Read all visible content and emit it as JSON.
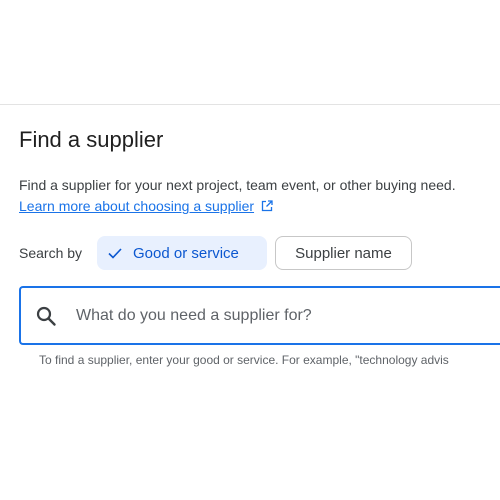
{
  "page": {
    "title": "Find a supplier",
    "description": "Find a supplier for your next project, team event, or other buying need.",
    "learn_more_link": "Learn more about choosing a supplier",
    "learn_more_icon": "external-link-icon"
  },
  "search_by": {
    "label": "Search by",
    "options": [
      {
        "label": "Good or service",
        "selected": true,
        "icon": "check-icon"
      },
      {
        "label": "Supplier name",
        "selected": false
      }
    ]
  },
  "search": {
    "icon": "search-icon",
    "placeholder": "What do you need a supplier for?",
    "value": "",
    "hint": "To find a supplier, enter your good or service. For example, \"technology advis"
  },
  "colors": {
    "accent": "#1a73e8",
    "chip_selected_bg": "#e8f0fe",
    "chip_selected_text": "#0b57d0",
    "divider": "#e3e3e3"
  }
}
